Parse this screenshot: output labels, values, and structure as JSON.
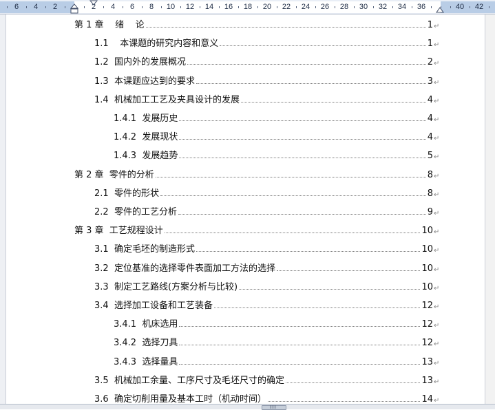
{
  "ruler": {
    "numbers": [
      "6",
      "4",
      "2",
      "2",
      "4",
      "6",
      "8",
      "10",
      "12",
      "14",
      "16",
      "18",
      "20",
      "22",
      "24",
      "26",
      "28",
      "30",
      "32",
      "34",
      "36",
      "40",
      "42"
    ]
  },
  "toc": {
    "paragraph_mark": "↵",
    "entries": [
      {
        "label": "第 1 章    绪    论",
        "page": "1",
        "level": 1
      },
      {
        "label": "1.1    本课题的研究内容和意义",
        "page": "1",
        "level": 2
      },
      {
        "label": "1.2  国内外的发展概况",
        "page": "2",
        "level": 2
      },
      {
        "label": "1.3  本课题应达到的要求",
        "page": "3",
        "level": 2
      },
      {
        "label": "1.4  机械加工工艺及夹具设计的发展",
        "page": "4",
        "level": 2
      },
      {
        "label": "1.4.1  发展历史",
        "page": "4",
        "level": 3
      },
      {
        "label": "1.4.2  发展现状",
        "page": "4",
        "level": 3
      },
      {
        "label": "1.4.3  发展趋势",
        "page": "5",
        "level": 3
      },
      {
        "label": "第 2 章  零件的分析",
        "page": "8",
        "level": 1
      },
      {
        "label": "2.1  零件的形状",
        "page": "8",
        "level": 2
      },
      {
        "label": "2.2  零件的工艺分析",
        "page": "9",
        "level": 2
      },
      {
        "label": "第 3 章  工艺规程设计",
        "page": "10",
        "level": 1
      },
      {
        "label": "3.1  确定毛坯的制造形式",
        "page": "10",
        "level": 2
      },
      {
        "label": "3.2  定位基准的选择零件表面加工方法的选择",
        "page": "10",
        "level": 2
      },
      {
        "label": "3.3  制定工艺路线(方案分析与比较)",
        "page": "10",
        "level": 2
      },
      {
        "label": "3.4  选择加工设备和工艺装备",
        "page": "12",
        "level": 2
      },
      {
        "label": "3.4.1  机床选用",
        "page": "12",
        "level": 3
      },
      {
        "label": "3.4.2  选择刀具",
        "page": "12",
        "level": 3
      },
      {
        "label": "3.4.3  选择量具",
        "page": "13",
        "level": 3
      },
      {
        "label": "3.5  机械加工余量、工序尺寸及毛坯尺寸的确定",
        "page": "13",
        "level": 2
      },
      {
        "label": "3.6  确定切削用量及基本工时（机动时间）",
        "page": "14",
        "level": 2
      }
    ]
  }
}
